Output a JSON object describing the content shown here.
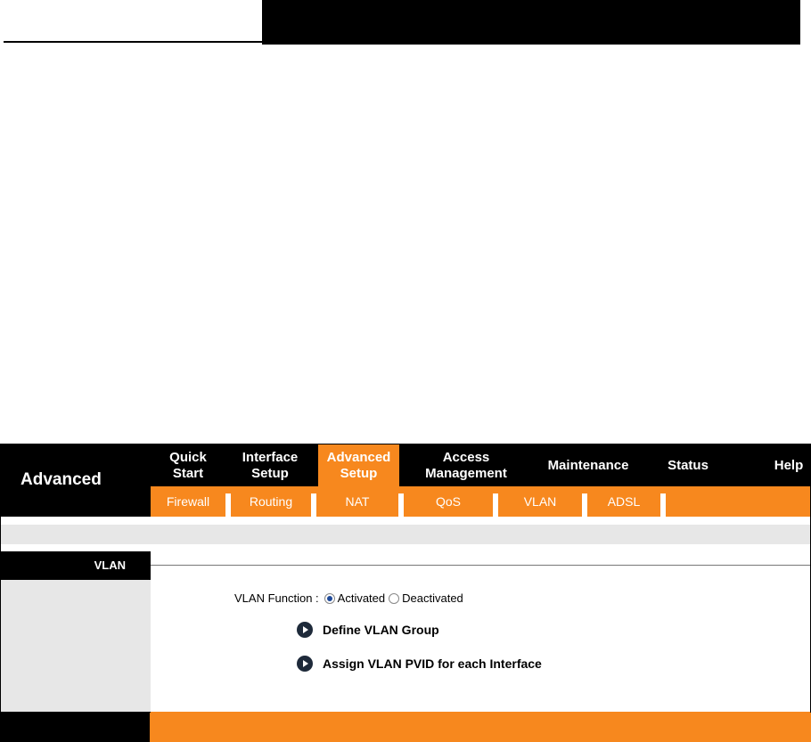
{
  "brand": {
    "label": "Advanced"
  },
  "main_nav": [
    {
      "label": "Quick\nStart",
      "active": false
    },
    {
      "label": "Interface\nSetup",
      "active": false
    },
    {
      "label": "Advanced\nSetup",
      "active": true
    },
    {
      "label": "Access\nManagement",
      "active": false
    },
    {
      "label": "Maintenance",
      "active": false
    },
    {
      "label": "Status",
      "active": false
    },
    {
      "label": "Help",
      "active": false
    }
  ],
  "sub_nav": [
    "Firewall",
    "Routing",
    "NAT",
    "QoS",
    "VLAN",
    "ADSL"
  ],
  "section": {
    "label": "VLAN"
  },
  "vlan_function": {
    "label": "VLAN Function :",
    "options": [
      {
        "label": "Activated",
        "checked": true
      },
      {
        "label": "Deactivated",
        "checked": false
      }
    ]
  },
  "links": [
    {
      "label": "Define VLAN Group",
      "icon": "arrow-circle-icon"
    },
    {
      "label": "Assign VLAN PVID for each Interface",
      "icon": "arrow-circle-icon"
    }
  ],
  "colors": {
    "accent": "#f7881e",
    "dark": "#000000",
    "panel": "#e7e7e7"
  }
}
